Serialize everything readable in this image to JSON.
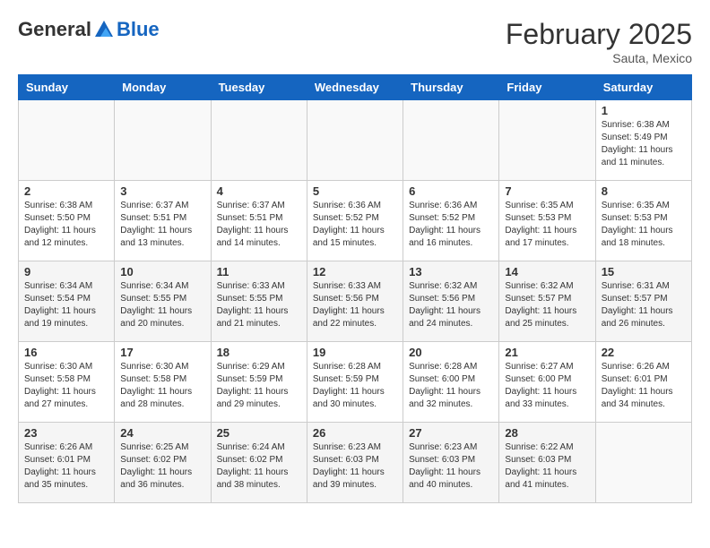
{
  "header": {
    "logo_general": "General",
    "logo_blue": "Blue",
    "month_title": "February 2025",
    "subtitle": "Sauta, Mexico"
  },
  "weekdays": [
    "Sunday",
    "Monday",
    "Tuesday",
    "Wednesday",
    "Thursday",
    "Friday",
    "Saturday"
  ],
  "weeks": [
    {
      "shade": false,
      "days": [
        {
          "num": "",
          "info": ""
        },
        {
          "num": "",
          "info": ""
        },
        {
          "num": "",
          "info": ""
        },
        {
          "num": "",
          "info": ""
        },
        {
          "num": "",
          "info": ""
        },
        {
          "num": "",
          "info": ""
        },
        {
          "num": "1",
          "info": "Sunrise: 6:38 AM\nSunset: 5:49 PM\nDaylight: 11 hours\nand 11 minutes."
        }
      ]
    },
    {
      "shade": false,
      "days": [
        {
          "num": "2",
          "info": "Sunrise: 6:38 AM\nSunset: 5:50 PM\nDaylight: 11 hours\nand 12 minutes."
        },
        {
          "num": "3",
          "info": "Sunrise: 6:37 AM\nSunset: 5:51 PM\nDaylight: 11 hours\nand 13 minutes."
        },
        {
          "num": "4",
          "info": "Sunrise: 6:37 AM\nSunset: 5:51 PM\nDaylight: 11 hours\nand 14 minutes."
        },
        {
          "num": "5",
          "info": "Sunrise: 6:36 AM\nSunset: 5:52 PM\nDaylight: 11 hours\nand 15 minutes."
        },
        {
          "num": "6",
          "info": "Sunrise: 6:36 AM\nSunset: 5:52 PM\nDaylight: 11 hours\nand 16 minutes."
        },
        {
          "num": "7",
          "info": "Sunrise: 6:35 AM\nSunset: 5:53 PM\nDaylight: 11 hours\nand 17 minutes."
        },
        {
          "num": "8",
          "info": "Sunrise: 6:35 AM\nSunset: 5:53 PM\nDaylight: 11 hours\nand 18 minutes."
        }
      ]
    },
    {
      "shade": true,
      "days": [
        {
          "num": "9",
          "info": "Sunrise: 6:34 AM\nSunset: 5:54 PM\nDaylight: 11 hours\nand 19 minutes."
        },
        {
          "num": "10",
          "info": "Sunrise: 6:34 AM\nSunset: 5:55 PM\nDaylight: 11 hours\nand 20 minutes."
        },
        {
          "num": "11",
          "info": "Sunrise: 6:33 AM\nSunset: 5:55 PM\nDaylight: 11 hours\nand 21 minutes."
        },
        {
          "num": "12",
          "info": "Sunrise: 6:33 AM\nSunset: 5:56 PM\nDaylight: 11 hours\nand 22 minutes."
        },
        {
          "num": "13",
          "info": "Sunrise: 6:32 AM\nSunset: 5:56 PM\nDaylight: 11 hours\nand 24 minutes."
        },
        {
          "num": "14",
          "info": "Sunrise: 6:32 AM\nSunset: 5:57 PM\nDaylight: 11 hours\nand 25 minutes."
        },
        {
          "num": "15",
          "info": "Sunrise: 6:31 AM\nSunset: 5:57 PM\nDaylight: 11 hours\nand 26 minutes."
        }
      ]
    },
    {
      "shade": false,
      "days": [
        {
          "num": "16",
          "info": "Sunrise: 6:30 AM\nSunset: 5:58 PM\nDaylight: 11 hours\nand 27 minutes."
        },
        {
          "num": "17",
          "info": "Sunrise: 6:30 AM\nSunset: 5:58 PM\nDaylight: 11 hours\nand 28 minutes."
        },
        {
          "num": "18",
          "info": "Sunrise: 6:29 AM\nSunset: 5:59 PM\nDaylight: 11 hours\nand 29 minutes."
        },
        {
          "num": "19",
          "info": "Sunrise: 6:28 AM\nSunset: 5:59 PM\nDaylight: 11 hours\nand 30 minutes."
        },
        {
          "num": "20",
          "info": "Sunrise: 6:28 AM\nSunset: 6:00 PM\nDaylight: 11 hours\nand 32 minutes."
        },
        {
          "num": "21",
          "info": "Sunrise: 6:27 AM\nSunset: 6:00 PM\nDaylight: 11 hours\nand 33 minutes."
        },
        {
          "num": "22",
          "info": "Sunrise: 6:26 AM\nSunset: 6:01 PM\nDaylight: 11 hours\nand 34 minutes."
        }
      ]
    },
    {
      "shade": true,
      "days": [
        {
          "num": "23",
          "info": "Sunrise: 6:26 AM\nSunset: 6:01 PM\nDaylight: 11 hours\nand 35 minutes."
        },
        {
          "num": "24",
          "info": "Sunrise: 6:25 AM\nSunset: 6:02 PM\nDaylight: 11 hours\nand 36 minutes."
        },
        {
          "num": "25",
          "info": "Sunrise: 6:24 AM\nSunset: 6:02 PM\nDaylight: 11 hours\nand 38 minutes."
        },
        {
          "num": "26",
          "info": "Sunrise: 6:23 AM\nSunset: 6:03 PM\nDaylight: 11 hours\nand 39 minutes."
        },
        {
          "num": "27",
          "info": "Sunrise: 6:23 AM\nSunset: 6:03 PM\nDaylight: 11 hours\nand 40 minutes."
        },
        {
          "num": "28",
          "info": "Sunrise: 6:22 AM\nSunset: 6:03 PM\nDaylight: 11 hours\nand 41 minutes."
        },
        {
          "num": "",
          "info": ""
        }
      ]
    }
  ]
}
